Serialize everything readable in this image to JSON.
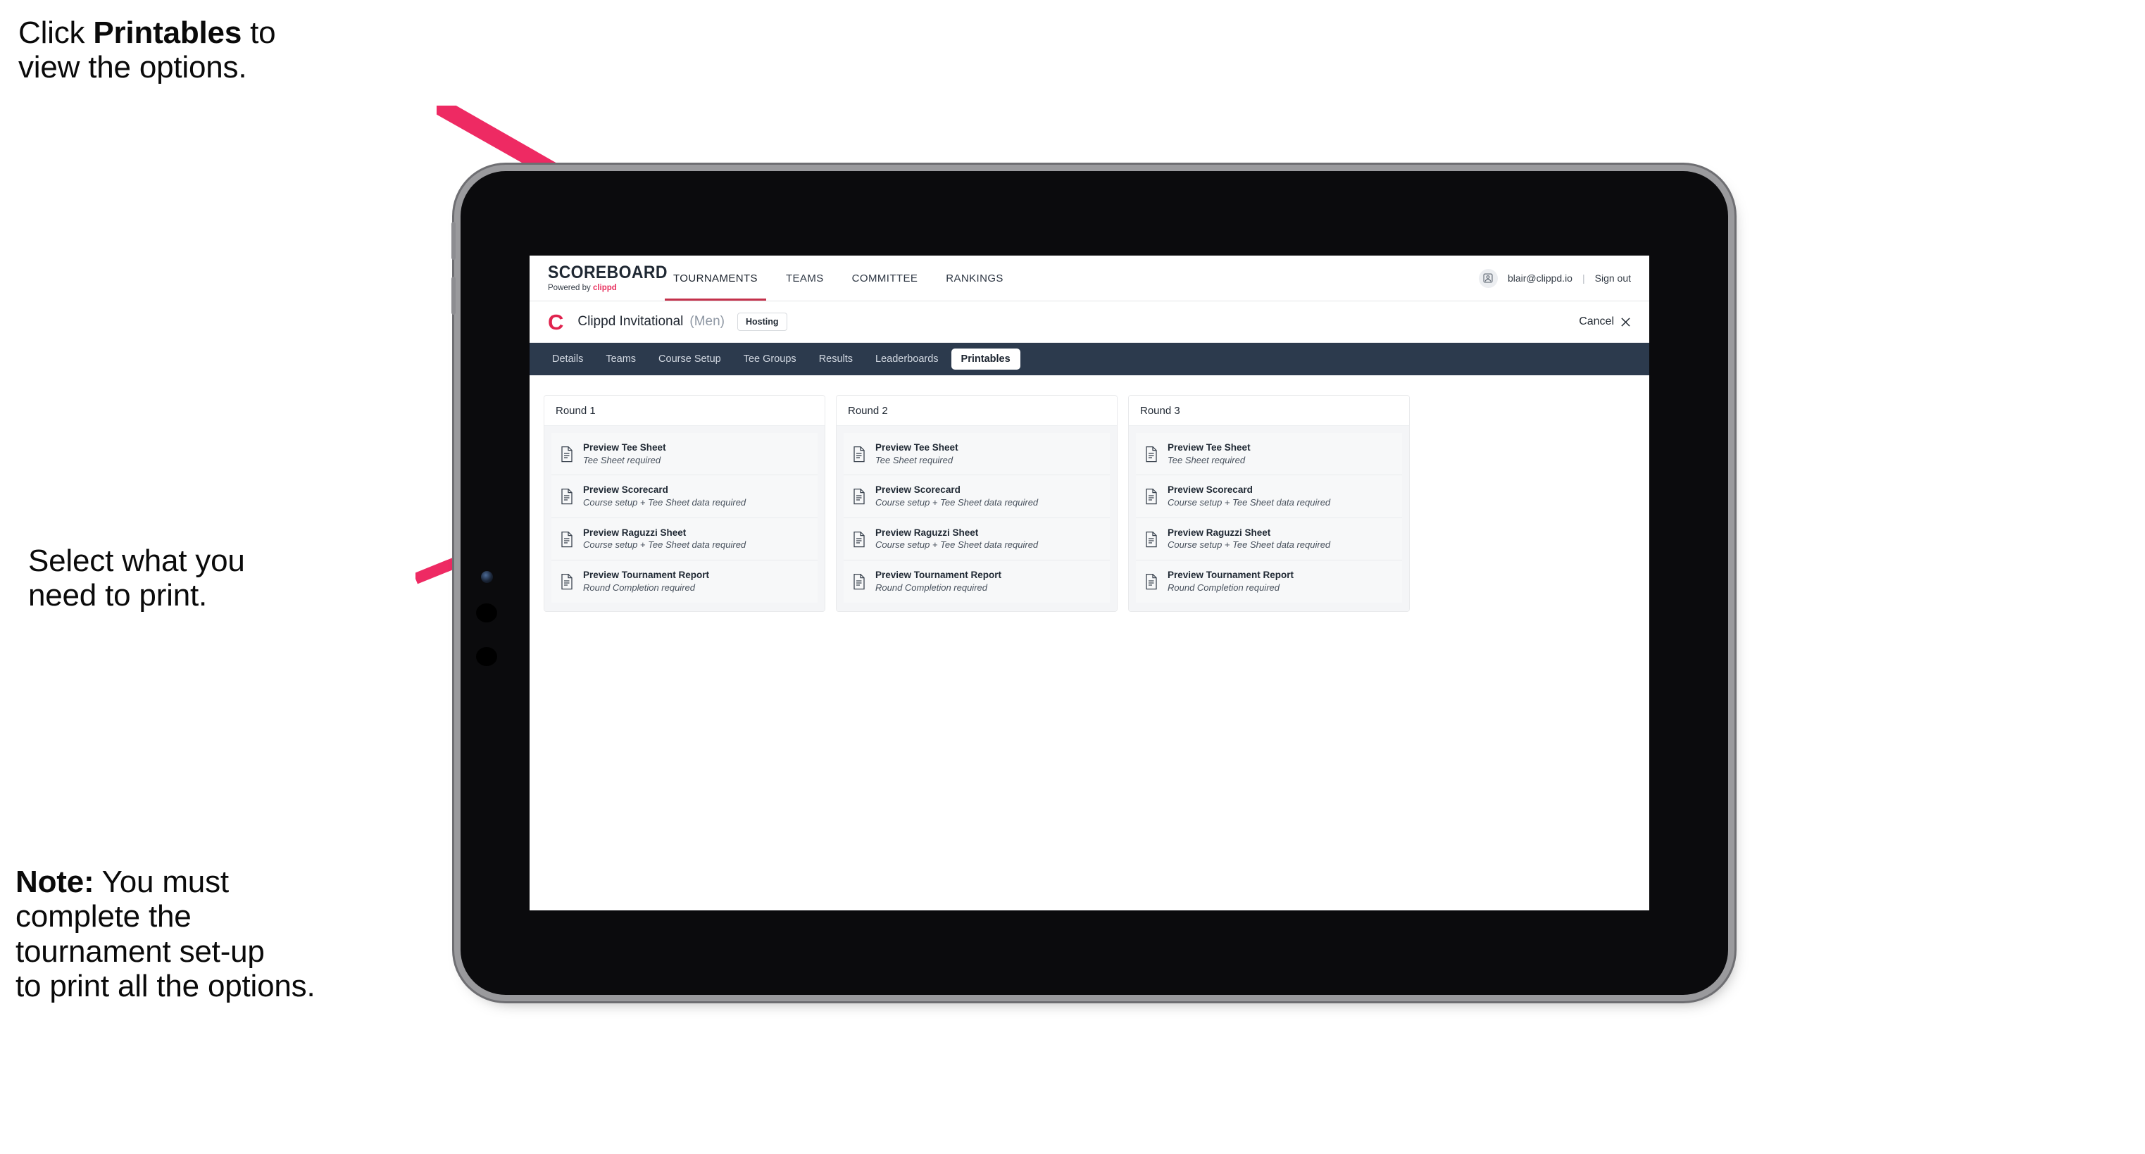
{
  "annotations": {
    "click_printables": "Click Printables to\nview the options.",
    "click_printables_prefix": "Click ",
    "click_printables_bold": "Printables",
    "click_printables_suffix": " to\nview the options.",
    "select_print": "Select what you\n need to print.",
    "note_bold": "Note:",
    "note_rest": " You must\ncomplete the\ntournament set-up\nto print all the options.",
    "arrow_color": "#ee2a63"
  },
  "app": {
    "brand": {
      "title": "SCOREBOARD",
      "powered_by": "Powered by ",
      "powered_by_brand": "clippd"
    },
    "main_nav": [
      {
        "label": "TOURNAMENTS",
        "active": true
      },
      {
        "label": "TEAMS",
        "active": false
      },
      {
        "label": "COMMITTEE",
        "active": false
      },
      {
        "label": "RANKINGS",
        "active": false
      }
    ],
    "account": {
      "avatar_icon": "user-avatar-icon",
      "email": "blair@clippd.io",
      "separator": "|",
      "sign_out": "Sign out"
    },
    "tournament": {
      "logo_letter": "C",
      "name": "Clippd Invitational",
      "gender": "(Men)",
      "status_badge": "Hosting",
      "cancel_label": "Cancel",
      "cancel_icon": "close-icon"
    },
    "sub_nav": [
      {
        "label": "Details",
        "active": false
      },
      {
        "label": "Teams",
        "active": false
      },
      {
        "label": "Course Setup",
        "active": false
      },
      {
        "label": "Tee Groups",
        "active": false
      },
      {
        "label": "Results",
        "active": false
      },
      {
        "label": "Leaderboards",
        "active": false
      },
      {
        "label": "Printables",
        "active": true
      }
    ],
    "colors": {
      "sub_nav_bg": "#2c3a4d",
      "brand_accent": "#e8315f",
      "tournament_logo": "#e0234e",
      "active_underline": "#c4314b"
    },
    "rounds": [
      {
        "title": "Round 1",
        "items": [
          {
            "icon": "document-icon",
            "title": "Preview Tee Sheet",
            "subtitle": "Tee Sheet required"
          },
          {
            "icon": "document-icon",
            "title": "Preview Scorecard",
            "subtitle": "Course setup + Tee Sheet data required"
          },
          {
            "icon": "document-icon",
            "title": "Preview Raguzzi Sheet",
            "subtitle": "Course setup + Tee Sheet data required"
          },
          {
            "icon": "document-icon",
            "title": "Preview Tournament Report",
            "subtitle": "Round Completion required"
          }
        ]
      },
      {
        "title": "Round 2",
        "items": [
          {
            "icon": "document-icon",
            "title": "Preview Tee Sheet",
            "subtitle": "Tee Sheet required"
          },
          {
            "icon": "document-icon",
            "title": "Preview Scorecard",
            "subtitle": "Course setup + Tee Sheet data required"
          },
          {
            "icon": "document-icon",
            "title": "Preview Raguzzi Sheet",
            "subtitle": "Course setup + Tee Sheet data required"
          },
          {
            "icon": "document-icon",
            "title": "Preview Tournament Report",
            "subtitle": "Round Completion required"
          }
        ]
      },
      {
        "title": "Round 3",
        "items": [
          {
            "icon": "document-icon",
            "title": "Preview Tee Sheet",
            "subtitle": "Tee Sheet required"
          },
          {
            "icon": "document-icon",
            "title": "Preview Scorecard",
            "subtitle": "Course setup + Tee Sheet data required"
          },
          {
            "icon": "document-icon",
            "title": "Preview Raguzzi Sheet",
            "subtitle": "Course setup + Tee Sheet data required"
          },
          {
            "icon": "document-icon",
            "title": "Preview Tournament Report",
            "subtitle": "Round Completion required"
          }
        ]
      }
    ]
  },
  "device": {
    "camera_icon": "front-camera-icon",
    "button_icons": [
      "side-button-icon",
      "side-button-icon"
    ]
  }
}
